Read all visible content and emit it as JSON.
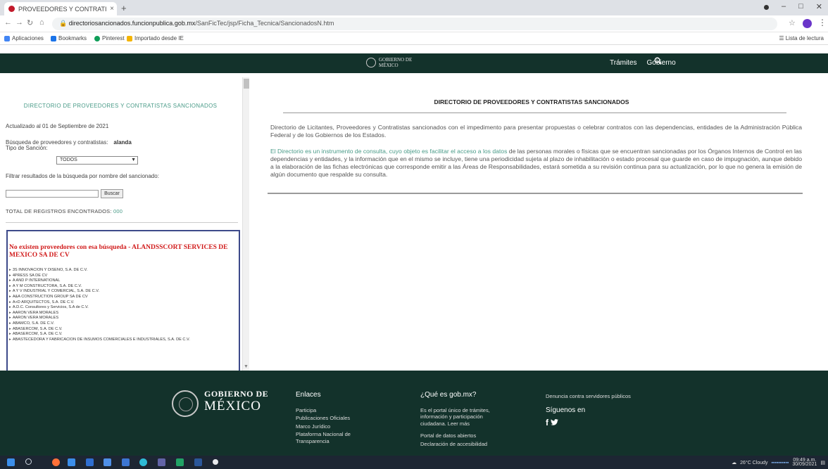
{
  "browser": {
    "tab_title": "PROVEEDORES Y CONTRATISTAS",
    "tab_close": "×",
    "new_tab": "+",
    "url_host": "directoriosancionados.funcionpublica.gob.mx",
    "url_path": "/SanFicTec/jsp/Ficha_Tecnica/SancionadosN.htm",
    "bookmarks": [
      {
        "label": "Aplicaciones",
        "icon": "apps-icon",
        "color": "#4285f4"
      },
      {
        "label": "Bookmarks",
        "icon": "bookmark-icon",
        "color": "#1a73e8"
      },
      {
        "label": "Pinterest",
        "icon": "pinterest-icon",
        "color": "#0f9d58"
      },
      {
        "label": "Importado desde IE",
        "icon": "folder-icon",
        "color": "#f4b400"
      }
    ],
    "reading_list": "Lista de lectura"
  },
  "site_header": {
    "logo_line1": "GOBIERNO DE",
    "logo_line2": "MÉXICO",
    "nav": [
      "Trámites",
      "Gobierno"
    ],
    "search_icon": "search-icon"
  },
  "left_panel": {
    "title": "DIRECTORIO DE PROVEEDORES Y CONTRATISTAS SANCIONADOS",
    "updated": "Actualizado al 01 de Septiembre de 2021",
    "search_label": "Búsqueda de proveedores y contratistas:",
    "search_value": "alanda",
    "sanction_label": "Tipo de Sanción:",
    "sanction_select": "TODOS",
    "filter_label": "Filtrar resultados de la búsqueda por nombre del sancionado:",
    "filter_button": "Buscar",
    "total_label": "TOTAL DE REGISTROS ENCONTRADOS:",
    "total_value": "000",
    "no_results": "No existen proveedores con esa búsqueda - ALANDSSCORT SERVICES DE MEXICO SA DE CV",
    "results": [
      "3S INNOVACIÓN Y DISEÑO, S.A. DE C.V.",
      "4PRESS SA DE CV",
      "A AND P INTERNATIONAL",
      "A Y M CONSTRUCTORA, S.A. DE C.V.",
      "A Y V INDUSTRIAL Y COMERCIAL, S.A. DE C.V.",
      "A&A CONSTRUCTION GROUP SA DE CV",
      "A+D ARQUITECTOS, S.A. DE C.V.",
      "A.D.C. Consultores y Servicios, S.A de C.V.",
      "AARON VERA MORALES",
      "AARON VERA MORALES",
      "ABAMCO, S.A. DE C.V.",
      "ABASERCOM, S.A. DE C.V.",
      "ABASERCOM, S.A. DE C.V.",
      "ABASTECEDORA Y FABRICACIÓN DE INSUMOS COMERCIALES E INDUSTRIALES, S.A. DE C.V."
    ]
  },
  "main": {
    "title": "DIRECTORIO DE PROVEEDORES Y CONTRATISTAS SANCIONADOS",
    "p1": "Directorio de Licitantes, Proveedores y Contratistas sancionados con el impedimento para presentar propuestas o celebrar contratos con las dependencias, entidades de la Administración Pública Federal y de los Gobiernos de los Estados.",
    "p2_highlight": "El Directorio es un instrumento de consulta, cuyo objeto es facilitar el acceso a los datos",
    "p2_rest": " de las personas morales o físicas que se encuentran sancionadas por los Órganos Internos de Control en las dependencias y entidades, y la información que en el mismo se incluye, tiene una periodicidad sujeta al plazo de inhabilitación o estado procesal que guarde en caso de impugnación, aunque debido a la elaboración de las fichas electrónicas que corresponde emitir a las Áreas de Responsabilidades, estará sometida a su revisión continua para su actualización, por lo que no genera la emisión de algún documento que respalde su consulta."
  },
  "footer": {
    "logo_line1": "GOBIERNO DE",
    "logo_line2": "MÉXICO",
    "links_title": "Enlaces",
    "links": [
      "Participa",
      "Publicaciones Oficiales",
      "Marco Jurídico",
      "Plataforma Nacional de",
      "Transparencia"
    ],
    "about_title": "¿Qué es gob.mx?",
    "about_text": [
      "Es el portal único de trámites,",
      "información y participación",
      "ciudadana. Leer más"
    ],
    "about_links": [
      "Portal de datos abiertos",
      "Declaración de accesibilidad"
    ],
    "report": "Denuncia contra servidores públicos",
    "follow": "Síguenos en",
    "social": "f  🐦"
  },
  "taskbar": {
    "weather": "26°C Cloudy",
    "time": "09:49 a.m.",
    "date": "30/09/2021",
    "icons": [
      {
        "name": "windows-start-icon",
        "color": "#3b8eea"
      },
      {
        "name": "search-icon",
        "color": "#cfd8e3"
      },
      {
        "name": "firefox-icon",
        "color": "#ff7139"
      },
      {
        "name": "photos-icon",
        "color": "#3b8eea"
      },
      {
        "name": "files-icon",
        "color": "#2f6fd1"
      },
      {
        "name": "store-icon",
        "color": "#4f90e8"
      },
      {
        "name": "shield-icon",
        "color": "#3c76d3"
      },
      {
        "name": "edge-icon",
        "color": "#2ebbd6"
      },
      {
        "name": "teams-icon",
        "color": "#6264a7"
      },
      {
        "name": "excel-icon",
        "color": "#21a366"
      },
      {
        "name": "word-icon",
        "color": "#2b579a"
      },
      {
        "name": "chrome-icon",
        "color": "#e8eaed"
      }
    ]
  }
}
